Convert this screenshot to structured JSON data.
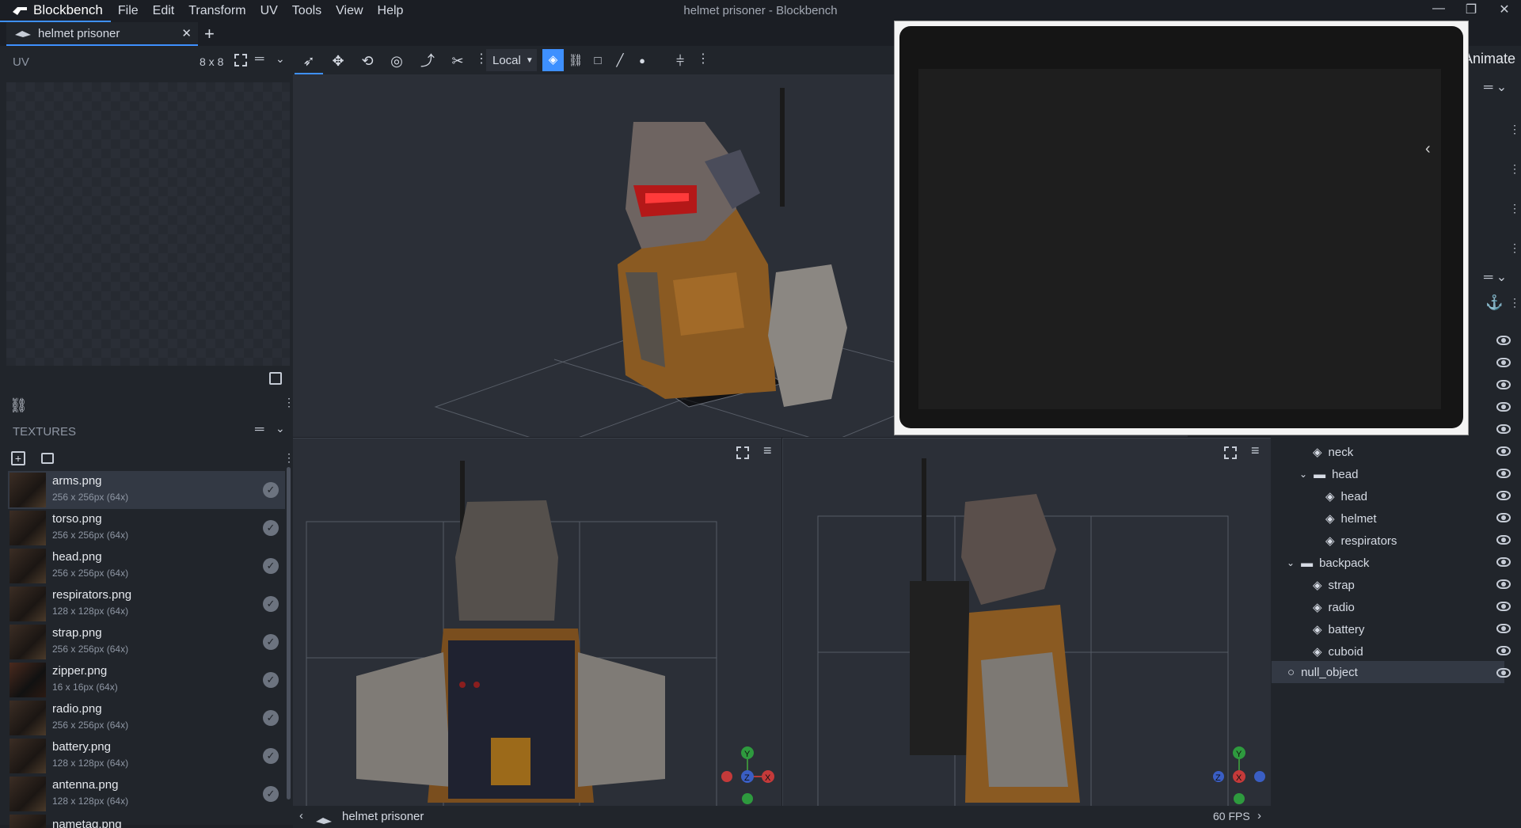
{
  "app": {
    "name": "Blockbench",
    "window_title": "helmet prisoner - Blockbench"
  },
  "menu": [
    "File",
    "Edit",
    "Transform",
    "UV",
    "Tools",
    "View",
    "Help"
  ],
  "window_controls": {
    "minimize": "—",
    "restore": "❐",
    "close": "✕"
  },
  "tab": {
    "label": "helmet prisoner",
    "close": "✕",
    "add": "+"
  },
  "uv_panel": {
    "title": "UV",
    "grid_size": "8 x 8"
  },
  "textures_panel": {
    "title": "TEXTURES",
    "items": [
      {
        "name": "arms.png",
        "size": "256 x 256px (64x)"
      },
      {
        "name": "torso.png",
        "size": "256 x 256px (64x)"
      },
      {
        "name": "head.png",
        "size": "256 x 256px (64x)"
      },
      {
        "name": "respirators.png",
        "size": "128 x 128px (64x)"
      },
      {
        "name": "strap.png",
        "size": "256 x 256px (64x)"
      },
      {
        "name": "zipper.png",
        "size": "16 x 16px (64x)"
      },
      {
        "name": "radio.png",
        "size": "256 x 256px (64x)"
      },
      {
        "name": "battery.png",
        "size": "128 x 128px (64x)"
      },
      {
        "name": "antenna.png",
        "size": "128 x 128px (64x)"
      },
      {
        "name": "nametag.png",
        "size": ""
      }
    ]
  },
  "toolbar": {
    "space_select": "Local"
  },
  "mode_label": "Animate",
  "outliner": {
    "items": [
      {
        "label": "neck",
        "type": "cube"
      },
      {
        "label": "head",
        "type": "folder"
      },
      {
        "label": "head",
        "type": "cube"
      },
      {
        "label": "helmet",
        "type": "cube"
      },
      {
        "label": "respirators",
        "type": "cube"
      },
      {
        "label": "backpack",
        "type": "folder"
      },
      {
        "label": "strap",
        "type": "cube"
      },
      {
        "label": "radio",
        "type": "cube"
      },
      {
        "label": "battery",
        "type": "cube"
      },
      {
        "label": "cuboid",
        "type": "cube"
      },
      {
        "label": "null_object",
        "type": "null"
      }
    ]
  },
  "viewport_axes": {
    "x": "X",
    "y": "Y",
    "z": "Z"
  },
  "status_bar": {
    "project": "helmet prisoner",
    "fps": "60 FPS"
  },
  "colors": {
    "accent": "#3e90ff",
    "panel": "#21252b",
    "background": "#1e2127"
  }
}
